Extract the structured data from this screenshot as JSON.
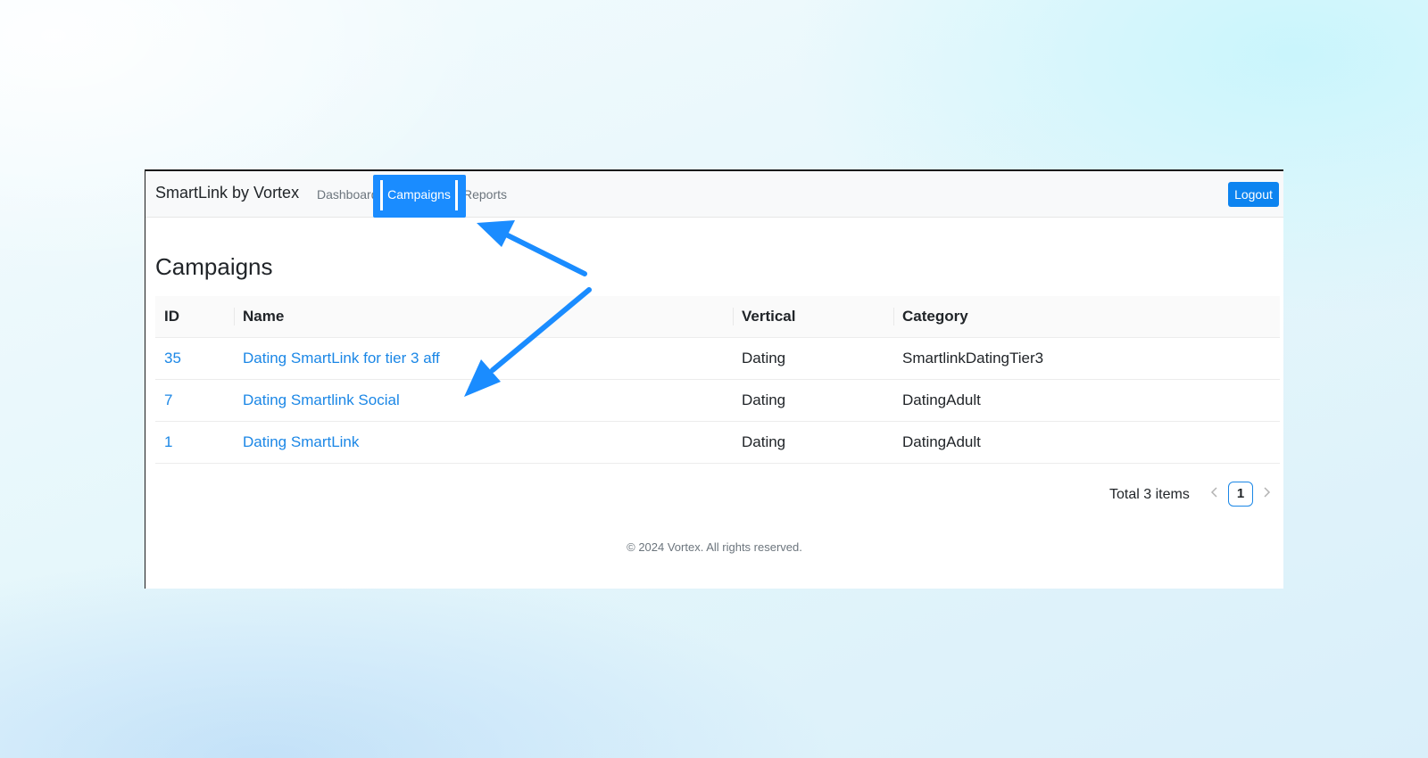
{
  "navbar": {
    "brand": "SmartLink by Vortex",
    "links": {
      "dashboard": "Dashboard",
      "campaigns": "Campaigns",
      "reports": "Reports"
    },
    "logout_label": "Logout"
  },
  "main": {
    "title": "Campaigns",
    "table": {
      "headers": {
        "id": "ID",
        "name": "Name",
        "vertical": "Vertical",
        "category": "Category"
      },
      "rows": [
        {
          "id": "35",
          "name": "Dating SmartLink for tier 3 aff",
          "vertical": "Dating",
          "category": "SmartlinkDatingTier3"
        },
        {
          "id": "7",
          "name": "Dating Smartlink Social",
          "vertical": "Dating",
          "category": "DatingAdult"
        },
        {
          "id": "1",
          "name": "Dating SmartLink",
          "vertical": "Dating",
          "category": "DatingAdult"
        }
      ]
    },
    "pagination": {
      "total_label": "Total 3 items",
      "current_page": "1",
      "prev_icon": "chevron-left-icon",
      "next_icon": "chevron-right-icon"
    }
  },
  "footer": {
    "text": "© 2024 Vortex. All rights reserved."
  },
  "annotations": {
    "highlight_color": "#1a8cff",
    "arrow_color": "#1a8cff"
  }
}
